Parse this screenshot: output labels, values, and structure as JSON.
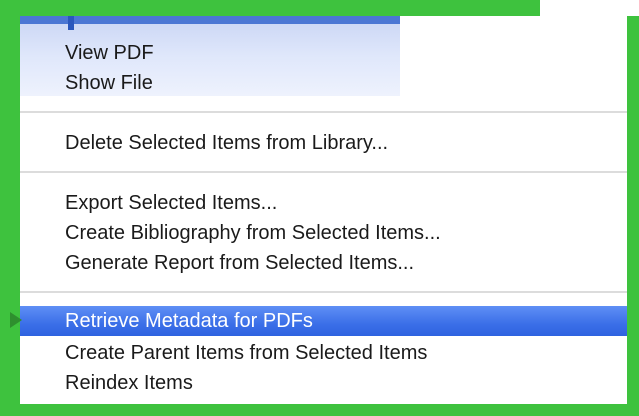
{
  "menu": {
    "items": [
      {
        "label": "View PDF",
        "highlighted": false
      },
      {
        "label": "Show File",
        "highlighted": false
      },
      {
        "label": "Delete Selected Items from Library...",
        "highlighted": false
      },
      {
        "label": "Export Selected Items...",
        "highlighted": false
      },
      {
        "label": "Create Bibliography from Selected Items...",
        "highlighted": false
      },
      {
        "label": "Generate Report from Selected Items...",
        "highlighted": false
      },
      {
        "label": "Retrieve Metadata for PDFs",
        "highlighted": true
      },
      {
        "label": "Create Parent Items from Selected Items",
        "highlighted": false
      },
      {
        "label": "Reindex Items",
        "highlighted": false
      }
    ]
  },
  "colors": {
    "frame": "#3ec23e",
    "highlight": "#3b6fe8",
    "menu_background": "#ffffff",
    "text": "#1a1a1a"
  },
  "icons": {
    "pointer": "arrow-right-icon"
  }
}
